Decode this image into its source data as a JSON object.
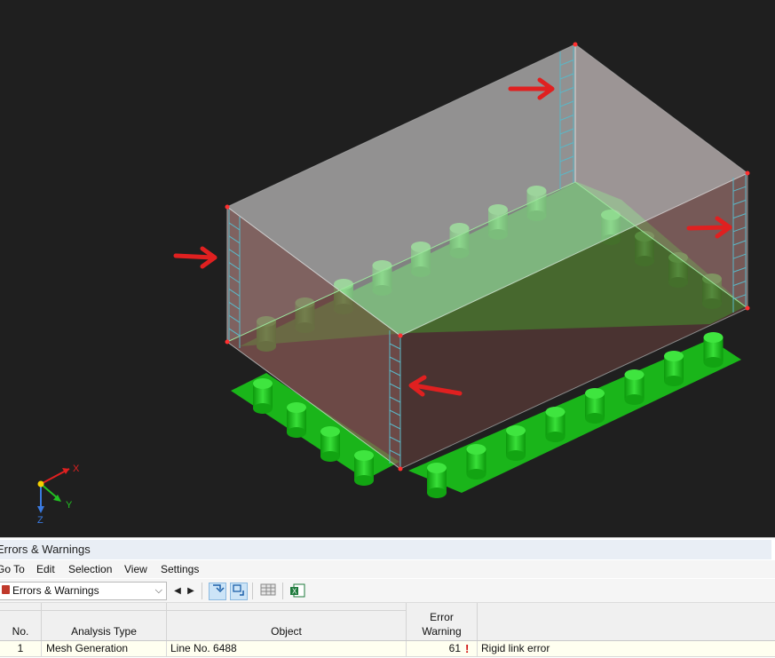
{
  "viewport": {
    "axes": {
      "x_label": "X",
      "y_label": "Y",
      "z_label": "Z"
    }
  },
  "panel": {
    "title": "Errors & Warnings",
    "menu": [
      "Go To",
      "Edit",
      "Selection",
      "View",
      "Settings"
    ],
    "toolbar": {
      "dropdown_value": "Errors & Warnings"
    },
    "table": {
      "headers": {
        "no": "No.",
        "analysis_type": "Analysis Type",
        "object": "Object",
        "error_warning_line1": "Error",
        "error_warning_line2": "Warning",
        "description": ""
      },
      "rows": [
        {
          "no": "1",
          "analysis_type": "Mesh Generation",
          "object": "Line No. 6488",
          "error_warning": "61",
          "description": "Rigid link error"
        }
      ]
    }
  },
  "colors": {
    "viewport_bg": "#1f1f1f",
    "support_green": "#22cc22",
    "wall_fill": "#8a5a55",
    "arrow_red": "#e02020",
    "warning_red": "#d01010"
  }
}
